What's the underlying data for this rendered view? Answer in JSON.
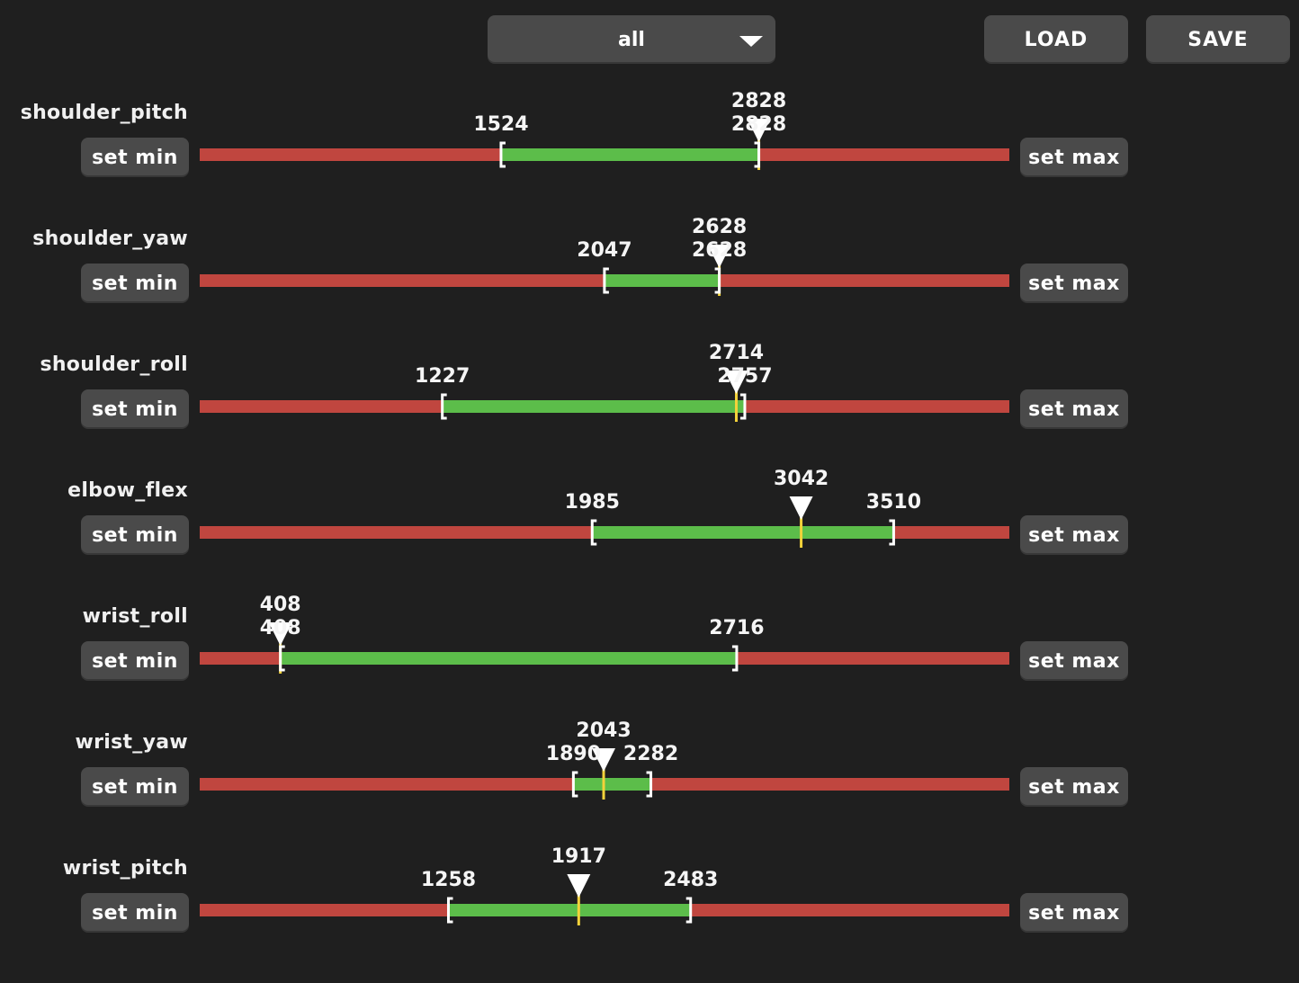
{
  "toolbar": {
    "dropdown_value": "all",
    "load_label": "LOAD",
    "save_label": "SAVE"
  },
  "colors": {
    "background": "#1f1f1f",
    "track_out_of_range": "#c0463f",
    "track_in_range": "#5cbd4a",
    "position_marker": "#f3d23a",
    "bracket": "#ffffff"
  },
  "range_scale": {
    "min": 0,
    "max": 4095
  },
  "motors": [
    {
      "name": "shoulder_pitch",
      "min": 1524,
      "max": 2828,
      "goal": 2828,
      "present": 2828,
      "min_label": "1524",
      "max_label": "2828",
      "goal_label": "2828",
      "set_min_label": "set min",
      "set_max_label": "set max"
    },
    {
      "name": "shoulder_yaw",
      "min": 2047,
      "max": 2628,
      "goal": 2628,
      "present": 2628,
      "min_label": "2047",
      "max_label": "2628",
      "goal_label": "2628",
      "set_min_label": "set min",
      "set_max_label": "set max"
    },
    {
      "name": "shoulder_roll",
      "min": 1227,
      "max": 2757,
      "goal": 2714,
      "present": 2714,
      "min_label": "1227",
      "max_label": "2757",
      "goal_label": "2714",
      "set_min_label": "set min",
      "set_max_label": "set max"
    },
    {
      "name": "elbow_flex",
      "min": 1985,
      "max": 3510,
      "goal": 3042,
      "present": 3042,
      "min_label": "1985",
      "max_label": "3510",
      "goal_label": "3042",
      "set_min_label": "set min",
      "set_max_label": "set max"
    },
    {
      "name": "wrist_roll",
      "min": 408,
      "max": 2716,
      "goal": 408,
      "present": 408,
      "min_label": "408",
      "max_label": "2716",
      "goal_label": "408",
      "set_min_label": "set min",
      "set_max_label": "set max"
    },
    {
      "name": "wrist_yaw",
      "min": 1890,
      "max": 2282,
      "goal": 2043,
      "present": 2043,
      "min_label": "1890",
      "max_label": "2282",
      "goal_label": "2043",
      "set_min_label": "set min",
      "set_max_label": "set max"
    },
    {
      "name": "wrist_pitch",
      "min": 1258,
      "max": 2483,
      "goal": 1917,
      "present": 1917,
      "min_label": "1258",
      "max_label": "2483",
      "goal_label": "1917",
      "set_min_label": "set min",
      "set_max_label": "set max"
    }
  ]
}
